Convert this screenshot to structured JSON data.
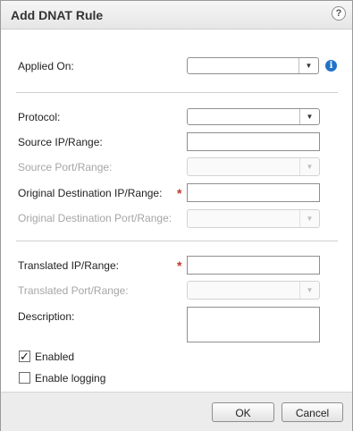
{
  "dialog": {
    "title": "Add DNAT Rule",
    "help_icon": "help-icon"
  },
  "applied_on": {
    "label": "Applied On:",
    "value": ""
  },
  "protocol": {
    "label": "Protocol:",
    "value": ""
  },
  "source_ip": {
    "label": "Source IP/Range:",
    "value": ""
  },
  "source_port": {
    "label": "Source Port/Range:",
    "value": "",
    "disabled": true
  },
  "orig_dest_ip": {
    "label": "Original Destination IP/Range:",
    "value": "",
    "required": true
  },
  "orig_dest_port": {
    "label": "Original Destination Port/Range:",
    "value": "",
    "disabled": true
  },
  "translated_ip": {
    "label": "Translated IP/Range:",
    "value": "",
    "required": true
  },
  "translated_port": {
    "label": "Translated Port/Range:",
    "value": "",
    "disabled": true
  },
  "description": {
    "label": "Description:",
    "value": ""
  },
  "enabled": {
    "label": "Enabled",
    "checked": true
  },
  "enable_logging": {
    "label": "Enable logging",
    "checked": false
  },
  "footer": {
    "ok": "OK",
    "cancel": "Cancel"
  },
  "colors": {
    "required": "#c0392b",
    "info": "#1f73c8"
  }
}
